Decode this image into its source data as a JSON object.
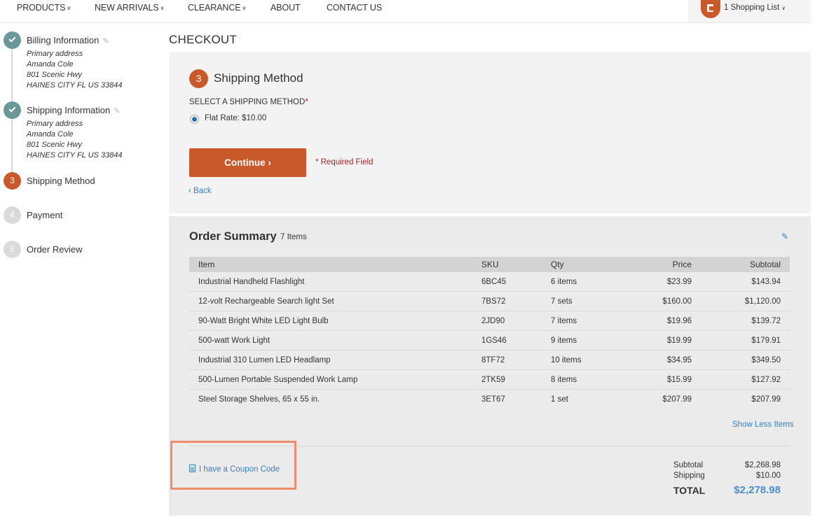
{
  "nav": {
    "items": [
      {
        "label": "PRODUCTS",
        "chevron": true
      },
      {
        "label": "NEW ARRIVALS",
        "chevron": true
      },
      {
        "label": "CLEARANCE",
        "chevron": true
      },
      {
        "label": "ABOUT",
        "chevron": false
      },
      {
        "label": "CONTACT US",
        "chevron": false
      }
    ],
    "shopping_list": "1 Shopping List"
  },
  "steps": [
    {
      "number": "1",
      "title": "Billing Information",
      "state": "done",
      "address": [
        "Primary address",
        "Amanda Cole",
        "801 Scenic Hwy",
        "HAINES CITY FL US 33844"
      ]
    },
    {
      "number": "2",
      "title": "Shipping Information",
      "state": "done",
      "address": [
        "Primary address",
        "Amanda Cole",
        "801 Scenic Hwy",
        "HAINES CITY FL US 33844"
      ]
    },
    {
      "number": "3",
      "title": "Shipping Method",
      "state": "current"
    },
    {
      "number": "4",
      "title": "Payment",
      "state": "todo"
    },
    {
      "number": "5",
      "title": "Order Review",
      "state": "todo"
    }
  ],
  "checkout": {
    "title": "CHECKOUT",
    "shipping": {
      "number": "3",
      "title": "Shipping Method",
      "label": "SELECT A SHIPPING METHOD",
      "required_mark": "*",
      "option": "Flat Rate: $10.00",
      "continue": "Continue",
      "required_note": "* Required Field",
      "back": "Back"
    },
    "summary": {
      "title": "Order Summary",
      "count": "7 Items",
      "columns": [
        "Item",
        "SKU",
        "Qty",
        "Price",
        "Subtotal"
      ],
      "rows": [
        [
          "Industrial Handheld Flashlight",
          "6BC45",
          "6 items",
          "$23.99",
          "$143.94"
        ],
        [
          "12-volt Rechargeable Search light Set",
          "7BS72",
          "7 sets",
          "$160.00",
          "$1,120.00"
        ],
        [
          "90-Watt Bright White LED Light Bulb",
          "2JD90",
          "7 items",
          "$19.96",
          "$139.72"
        ],
        [
          "500-watt Work Light",
          "1GS46",
          "9 items",
          "$19.99",
          "$179.91"
        ],
        [
          "Industrial 310 Lumen LED Headlamp",
          "8TF72",
          "10 items",
          "$34.95",
          "$349.50"
        ],
        [
          "500-Lumen Portable Suspended Work Lamp",
          "2TK59",
          "8 items",
          "$15.99",
          "$127.92"
        ],
        [
          "Steel Storage Shelves, 65 x 55 in.",
          "3ET67",
          "1 set",
          "$207.99",
          "$207.99"
        ]
      ],
      "show_less": "Show Less Items",
      "coupon": "I have a Coupon Code",
      "subtotal_label": "Subtotal",
      "subtotal": "$2,268.98",
      "shipping_label": "Shipping",
      "shipping": "$10.00",
      "total_label": "TOTAL",
      "total": "$2,278.98"
    }
  },
  "colors": {
    "accent": "#c9592b",
    "link": "#3a7ec0",
    "done_step": "#6a9898",
    "highlight_box": "#ef8d6d"
  }
}
